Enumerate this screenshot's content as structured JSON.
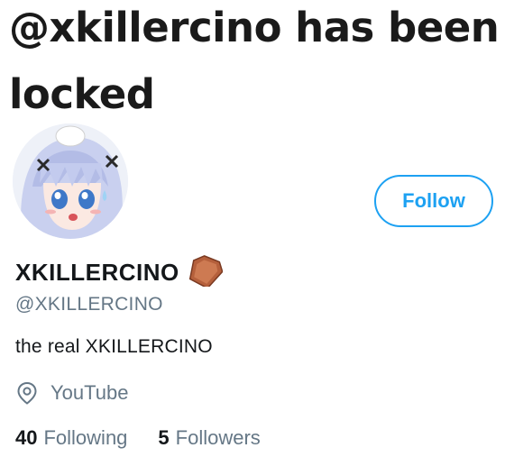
{
  "banner": {
    "title": "@xkillercino has been locked"
  },
  "profile": {
    "display_name": "XKILLERCINO",
    "handle": "@XKILLERCINO",
    "bio": "the real XKILLERCINO",
    "location": "YouTube",
    "name_emoji_icon": "coffin-icon",
    "location_icon": "location-pin-icon"
  },
  "actions": {
    "follow_label": "Follow"
  },
  "stats": {
    "following_count": "40",
    "following_label": "Following",
    "followers_count": "5",
    "followers_label": "Followers"
  },
  "colors": {
    "accent": "#1da1f2",
    "secondary_text": "#657786",
    "primary_text": "#14171a"
  }
}
